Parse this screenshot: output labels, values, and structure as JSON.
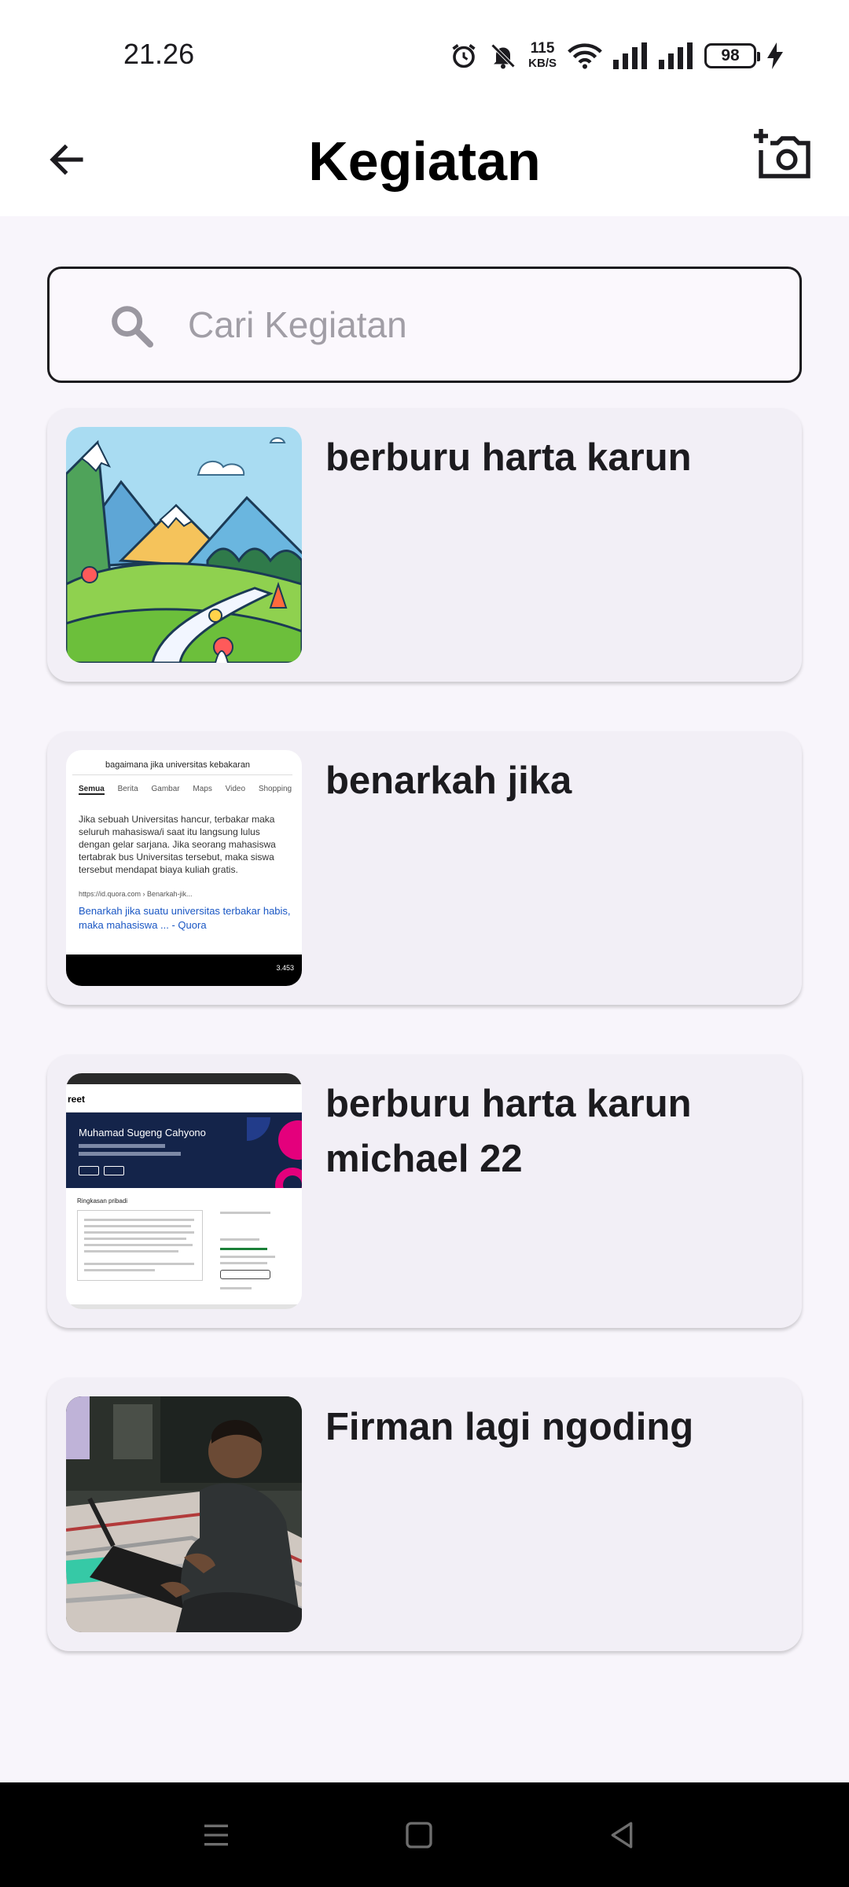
{
  "status_bar": {
    "time": "21.26",
    "net_speed_value": "115",
    "net_speed_unit": "KB/S",
    "battery": "98"
  },
  "app_bar": {
    "title": "Kegiatan"
  },
  "search": {
    "placeholder": "Cari Kegiatan"
  },
  "activities": [
    {
      "title": "berburu harta karun",
      "thumbnail": "landscape-illustration"
    },
    {
      "title": "benarkah jika",
      "thumbnail": "search-result-screenshot",
      "thumb_text": {
        "query": "bagaimana jika universitas kebakaran",
        "tabs": [
          "Semua",
          "Berita",
          "Gambar",
          "Maps",
          "Video",
          "Shopping"
        ],
        "snippet": "Jika sebuah Universitas hancur, terbakar maka seluruh mahasiswa/i saat itu langsung lulus dengan gelar sarjana. Jika seorang mahasiswa tertabrak bus Universitas tersebut, maka siswa tersebut mendapat biaya kuliah gratis.",
        "url": "https://id.quora.com › Benarkah-jik...",
        "link": "Benarkah jika suatu universitas terbakar habis, maka mahasiswa ... - Quora",
        "views": "3.453"
      }
    },
    {
      "title": "berburu harta karun michael 22",
      "thumbnail": "profile-page-screenshot",
      "thumb_text": {
        "logo": "reet",
        "name": "Muhamad Sugeng Cahyono",
        "section": "Ringkasan pribadi"
      }
    },
    {
      "title": "Firman lagi ngoding",
      "thumbnail": "person-coding-photo"
    }
  ],
  "colors": {
    "background": "#f8f5fb",
    "card": "#f2eff6",
    "text": "#1c1b1f",
    "placeholder": "#a19ea6"
  },
  "icons": {
    "back": "arrow-left-icon",
    "camera": "add-photo-icon",
    "search": "search-icon"
  }
}
